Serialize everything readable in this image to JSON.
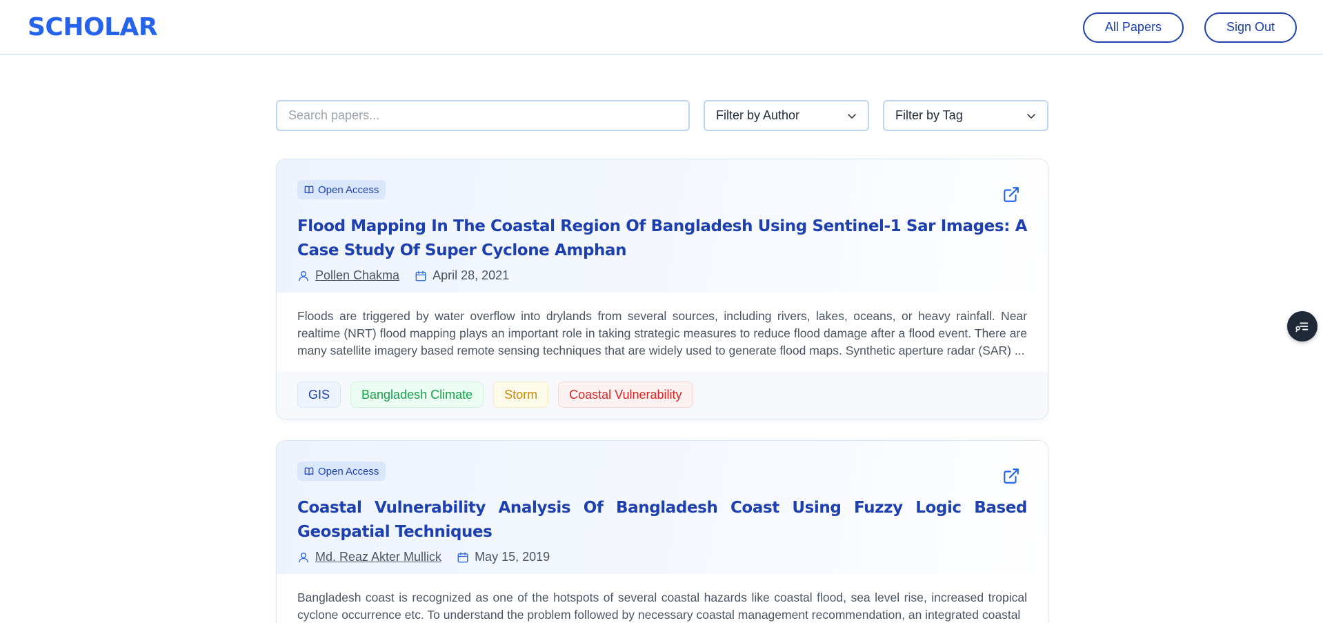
{
  "header": {
    "logo": "SCHOLAR",
    "nav": [
      {
        "label": "All Papers"
      },
      {
        "label": "Sign Out"
      }
    ]
  },
  "filters": {
    "search_placeholder": "Search papers...",
    "author_select": "Filter by Author",
    "tag_select": "Filter by Tag"
  },
  "papers": [
    {
      "badge": "Open Access",
      "title": "Flood Mapping In The Coastal Region Of Bangladesh Using Sentinel-1 Sar Images: A Case Study Of Super Cyclone Amphan",
      "author": "Pollen Chakma",
      "date": "April 28, 2021",
      "abstract": "Floods are triggered by water overflow into drylands from several sources, including rivers, lakes, oceans, or heavy rainfall. Near realtime (NRT) flood mapping plays an important role in taking strategic measures to reduce flood damage after a flood event. There are many satellite imagery based remote sensing techniques that are widely used to generate flood maps. Synthetic aperture radar (SAR) ...",
      "tags": [
        {
          "label": "GIS",
          "color": "blue"
        },
        {
          "label": "Bangladesh Climate",
          "color": "green"
        },
        {
          "label": "Storm",
          "color": "yellow"
        },
        {
          "label": "Coastal Vulnerability",
          "color": "red"
        }
      ]
    },
    {
      "badge": "Open Access",
      "title": "Coastal Vulnerability Analysis Of Bangladesh Coast Using Fuzzy Logic Based Geospatial Techniques",
      "author": "Md. Reaz Akter Mullick",
      "date": "May 15, 2019",
      "abstract": "Bangladesh coast is recognized as one of the hotspots of several coastal hazards like coastal flood, sea level rise, increased tropical cyclone occurrence etc. To understand the problem followed by necessary coastal management recommendation, an integrated coastal",
      "tags": []
    }
  ],
  "colors": {
    "brand": "#2563eb",
    "title": "#1e40af",
    "nav_border": "#1e40af"
  }
}
